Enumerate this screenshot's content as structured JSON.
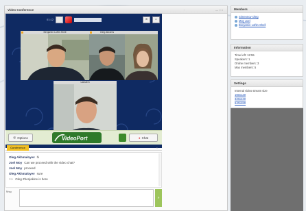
{
  "window": {
    "title": "Video Conference",
    "title_right": "— □ ×",
    "title_mid": "·"
  },
  "conference": {
    "counter": "01:12",
    "participants": [
      {
        "name": "Benjamin Loftin Shell"
      },
      {
        "name": "Oleg Abrams"
      },
      {
        "name": ""
      },
      {
        "name": "Lakslem"
      }
    ],
    "options_label": "Options",
    "chat_label": "Chat",
    "logo_text": "VideoPort"
  },
  "chat": {
    "tab_label": "Conference",
    "tab_close": "×",
    "messages": [
      {
        "name": "Oleg Akhmaloyev",
        "text": "hi"
      },
      {
        "name": "Joel Moy",
        "text": "Can we proceed with the video chat?"
      },
      {
        "name": "Joel Moy",
        "text": "proceed"
      },
      {
        "name": "Oleg Akhmaloyev",
        "text": "sure"
      },
      {
        "name": "Me",
        "text": "Oleg Zhenjakine is here"
      }
    ],
    "input_label": "Msg",
    "send_label": "»"
  },
  "members": {
    "title": "Members",
    "items": [
      "Simeonov Oleg",
      "Moy Joel",
      "Benjamin Loftin Shell"
    ]
  },
  "information": {
    "title": "Information",
    "lines": [
      "Time left: 12:55",
      "Speakers: 1",
      "Online members: 3",
      "Max members: 5"
    ]
  },
  "settings": {
    "title": "Settings",
    "lines": [
      "Internal video stream size"
    ],
    "links": [
      "160x120",
      "320x240",
      "640x480"
    ]
  },
  "colors": {
    "video_bg": "#0f2a62",
    "accent_green": "#9dc55c",
    "tab_yellow": "#f2c025",
    "link_blue": "#1a4fb8"
  }
}
